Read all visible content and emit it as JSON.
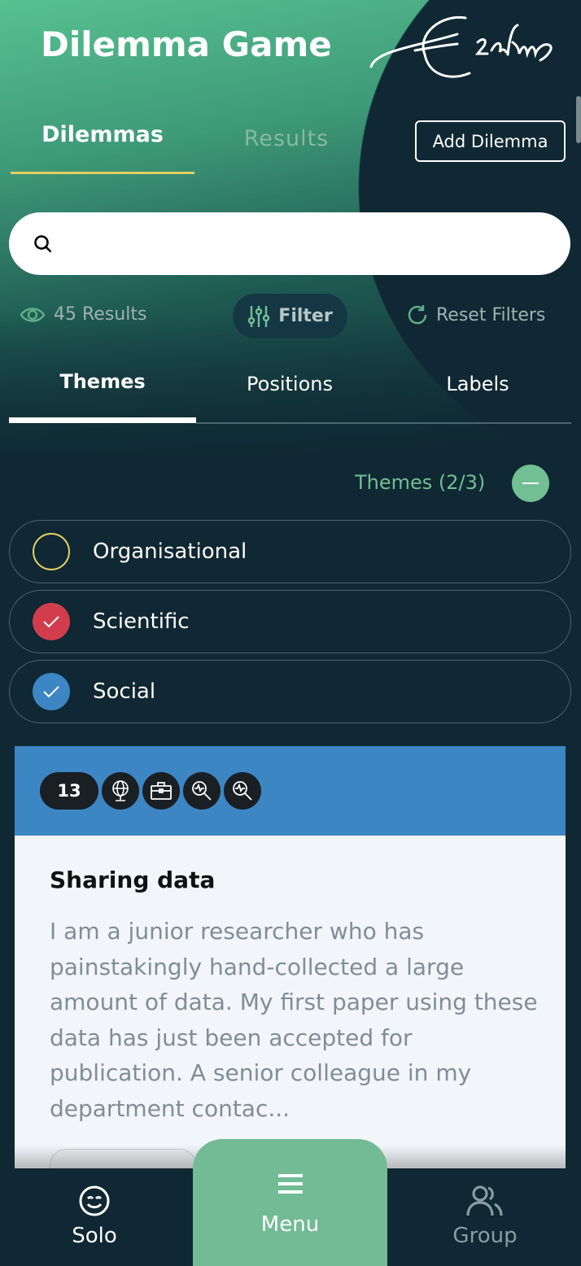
{
  "app": {
    "title": "Dilemma Game",
    "logo_text": "Erasmus"
  },
  "tabs": {
    "dilemmas": "Dilemmas",
    "results": "Results",
    "active": "Dilemmas"
  },
  "add_button": "Add Dilemma",
  "search": {
    "value": "",
    "placeholder": ""
  },
  "toolbar": {
    "results_count": "45 Results",
    "filter": "Filter",
    "reset": "Reset Filters"
  },
  "subtabs": {
    "items": [
      "Themes",
      "Positions",
      "Labels"
    ],
    "active": "Themes"
  },
  "themes": {
    "count_label": "Themes (2/3)",
    "options": [
      {
        "label": "Organisational",
        "checked": false,
        "color": "#e4cf63"
      },
      {
        "label": "Scientific",
        "checked": true,
        "color": "#d23d4d"
      },
      {
        "label": "Social",
        "checked": true,
        "color": "#3d86c4"
      }
    ]
  },
  "card": {
    "number": "13",
    "icons": [
      "globe-icon",
      "briefcase-icon",
      "magnifier-pulse-icon",
      "magnifier-pulse-icon"
    ],
    "title": "Sharing data",
    "description": "I am a junior researcher who has painstakingly hand-collected a large amount of data. My first paper using these data has just been accepted for publication. A senior colleague in my department contac...",
    "header_color": "#3d86c4"
  },
  "bottom_nav": {
    "solo": "Solo",
    "menu": "Menu",
    "group": "Group"
  },
  "colors": {
    "accent": "#72bb94",
    "background": "#0f2833",
    "tab_underline": "#e4cf63"
  }
}
